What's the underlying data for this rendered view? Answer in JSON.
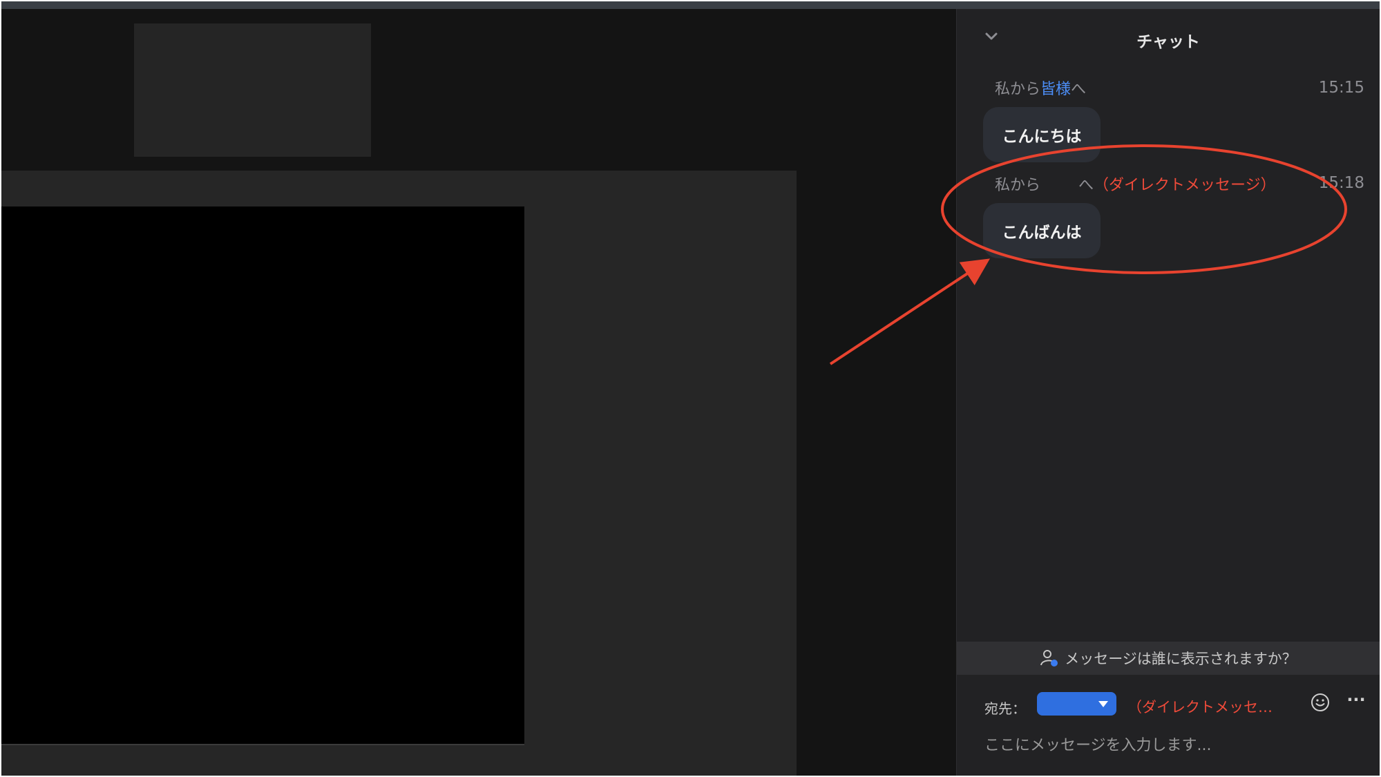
{
  "chat": {
    "title": "チャット",
    "messages": [
      {
        "sender": "私から",
        "recipient": "皆様",
        "suffix": "へ",
        "time": "15:15",
        "text": "こんにちは"
      },
      {
        "sender": "私から",
        "suffix": "へ",
        "note": "（ダイレクトメッセージ）",
        "time": "15:18",
        "text": "こんばんは"
      }
    ],
    "visibility_prompt": "メッセージは誰に表示されますか？",
    "recipient_label": "宛先：",
    "recipient_note": "（ダイレクトメッセ…",
    "more_label": "···",
    "input_placeholder": "ここにメッセージを入力します..."
  },
  "colors": {
    "accent_blue": "#4c8ef7",
    "annotation_red": "#e8432f",
    "panel_bg": "#222224",
    "bubble_bg": "#2c2f36"
  },
  "icons": {
    "collapse": "chevron-down-icon",
    "visibility": "user-visibility-icon",
    "emoji": "emoji-icon",
    "more": "more-icon"
  }
}
